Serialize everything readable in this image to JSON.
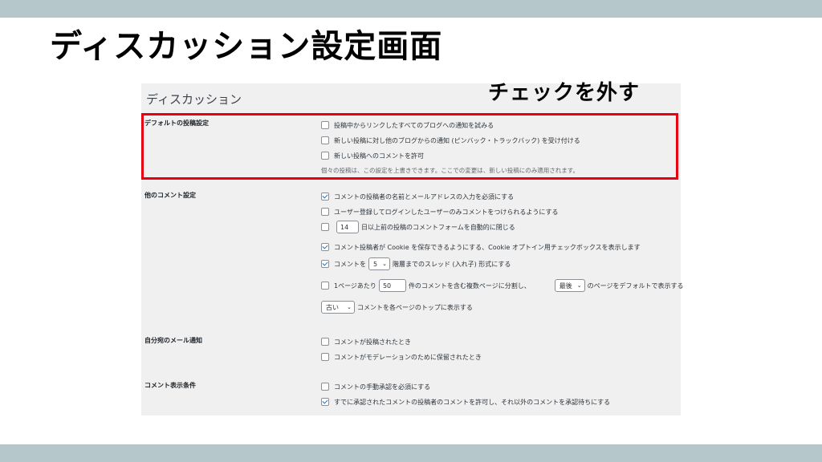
{
  "slide": {
    "title": "ディスカッション設定画面"
  },
  "screen": {
    "heading": "ディスカッション",
    "annotation": "チェックを外す"
  },
  "sections": {
    "default": {
      "label": "デフォルトの投稿設定",
      "items": [
        {
          "text": "投稿中からリンクしたすべてのブログへの通知を試みる",
          "checked": false
        },
        {
          "text": "新しい投稿に対し他のブログからの通知 (ピンバック・トラックバック) を受け付ける",
          "checked": false
        },
        {
          "text": "新しい投稿へのコメントを許可",
          "checked": false
        }
      ],
      "note": "個々の投稿は、この設定を上書きできます。ここでの変更は、新しい投稿にのみ適用されます。"
    },
    "other": {
      "label": "他のコメント設定",
      "require_name_email": "コメントの投稿者の名前とメールアドレスの入力を必須にする",
      "registered_only": "ユーザー登録してログインしたユーザーのみコメントをつけられるようにする",
      "close_days_value": "14",
      "close_days_text": "日以上前の投稿のコメントフォームを自動的に閉じる",
      "cookie_text": "コメント投稿者が Cookie を保存できるようにする、Cookie オプトイン用チェックボックスを表示します",
      "thread_prefix": "コメントを",
      "thread_value": "5",
      "thread_suffix": "階層までのスレッド (入れ子) 形式にする",
      "paging_prefix": "1ページあたり",
      "paging_value": "50",
      "paging_mid": "件のコメントを含む複数ページに分割し、",
      "paging_select": "最後",
      "paging_suffix": "のページをデフォルトで表示する",
      "order_select": "古い",
      "order_suffix": "コメントを各ページのトップに表示する"
    },
    "email": {
      "label": "自分宛のメール通知",
      "items": [
        {
          "text": "コメントが投稿されたとき",
          "checked": false
        },
        {
          "text": "コメントがモデレーションのために保留されたとき",
          "checked": false
        }
      ]
    },
    "appear": {
      "label": "コメント表示条件",
      "items": [
        {
          "text": "コメントの手動承認を必須にする",
          "checked": false
        },
        {
          "text": "すでに承認されたコメントの投稿者のコメントを許可し、それ以外のコメントを承認待ちにする",
          "checked": true
        }
      ]
    }
  },
  "colors": {
    "highlight": "#e60012",
    "band": "#b6c7cc",
    "check": "#2271b1"
  }
}
